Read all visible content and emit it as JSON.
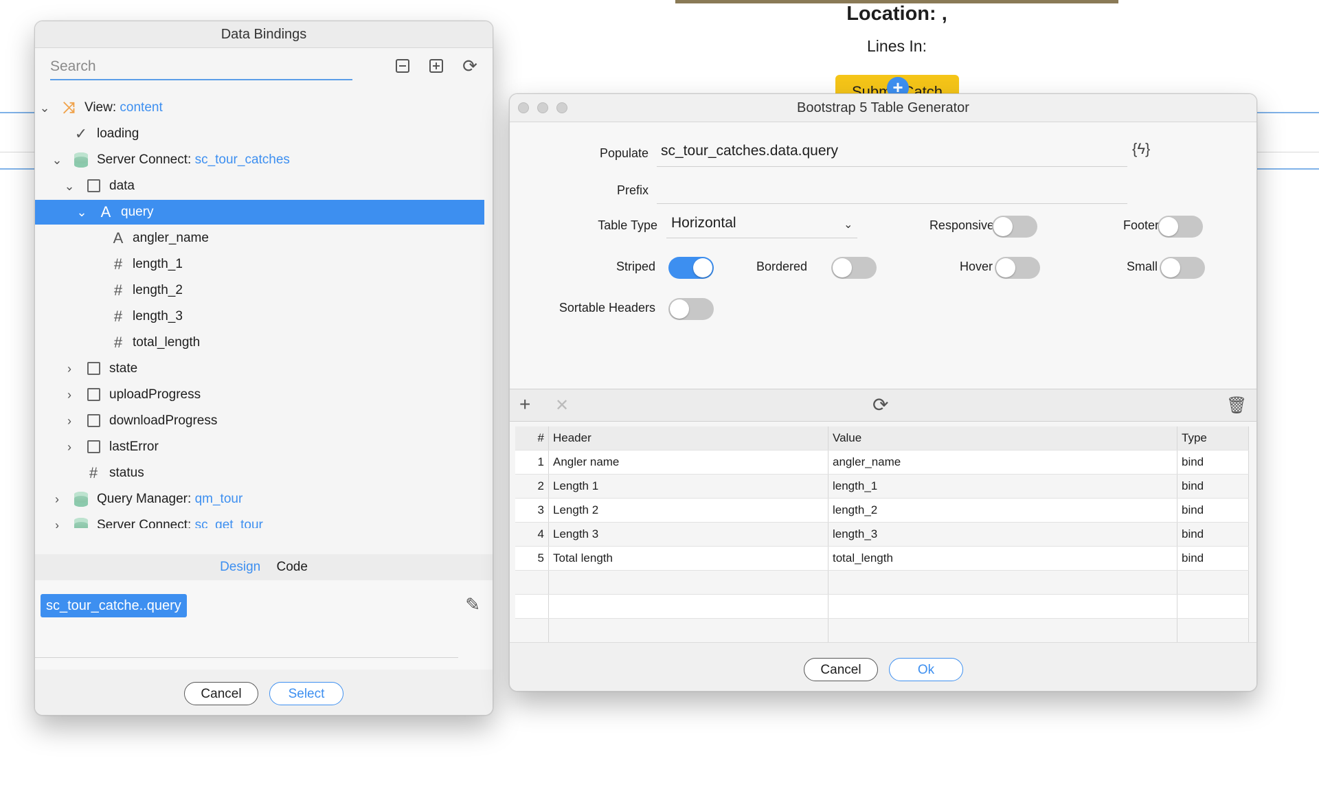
{
  "background": {
    "location_label": "Location: ,",
    "lines_label": "Lines In:",
    "submit_label": "Submit Catch"
  },
  "bindings_dialog": {
    "title": "Data Bindings",
    "search_placeholder": "Search",
    "tree": [
      {
        "label": "View:",
        "accent": "content",
        "icon": "view-icon"
      },
      {
        "label": "loading",
        "icon": "check-icon"
      },
      {
        "label": "Server Connect:",
        "accent": "sc_tour_catches",
        "icon": "database-icon"
      },
      {
        "label": "data",
        "icon": "cube-icon"
      },
      {
        "label": "query",
        "icon": "text-icon"
      },
      {
        "label": "angler_name",
        "icon": "text-icon"
      },
      {
        "label": "length_1",
        "icon": "hash-icon"
      },
      {
        "label": "length_2",
        "icon": "hash-icon"
      },
      {
        "label": "length_3",
        "icon": "hash-icon"
      },
      {
        "label": "total_length",
        "icon": "hash-icon"
      },
      {
        "label": "state",
        "icon": "cube-icon"
      },
      {
        "label": "uploadProgress",
        "icon": "cube-icon"
      },
      {
        "label": "downloadProgress",
        "icon": "cube-icon"
      },
      {
        "label": "lastError",
        "icon": "cube-icon"
      },
      {
        "label": "status",
        "icon": "hash-icon"
      },
      {
        "label": "Query Manager:",
        "accent": "qm_tour",
        "icon": "database-icon"
      },
      {
        "label": "Server Connect:",
        "accent": "sc_get_tour",
        "icon": "database-icon"
      }
    ],
    "tab_design": "Design",
    "tab_code": "Code",
    "expression": "sc_tour_catche..query",
    "cancel_label": "Cancel",
    "select_label": "Select"
  },
  "table_generator": {
    "title": "Bootstrap 5 Table Generator",
    "populate_label": "Populate",
    "populate_value": "sc_tour_catches.data.query",
    "prefix_label": "Prefix",
    "prefix_value": "",
    "table_type_label": "Table Type",
    "table_type_value": "Horizontal",
    "responsive_label": "Responsive",
    "footer_label": "Footer",
    "striped_label": "Striped",
    "bordered_label": "Bordered",
    "hover_label": "Hover",
    "small_label": "Small",
    "sortable_label": "Sortable Headers",
    "toggles": {
      "responsive": false,
      "footer": false,
      "striped": true,
      "bordered": false,
      "hover": false,
      "small": false,
      "sortable": false
    },
    "columns": {
      "num": "#",
      "header": "Header",
      "value": "Value",
      "type": "Type"
    },
    "rows": [
      {
        "num": "1",
        "header": "Angler name",
        "value": "angler_name",
        "type": "bind"
      },
      {
        "num": "2",
        "header": "Length 1",
        "value": "length_1",
        "type": "bind"
      },
      {
        "num": "3",
        "header": "Length 2",
        "value": "length_2",
        "type": "bind"
      },
      {
        "num": "4",
        "header": "Length 3",
        "value": "length_3",
        "type": "bind"
      },
      {
        "num": "5",
        "header": "Total length",
        "value": "total_length",
        "type": "bind"
      }
    ],
    "cancel_label": "Cancel",
    "ok_label": "Ok"
  },
  "colors": {
    "accent": "#3d8ff0",
    "submit": "#f5c518"
  }
}
